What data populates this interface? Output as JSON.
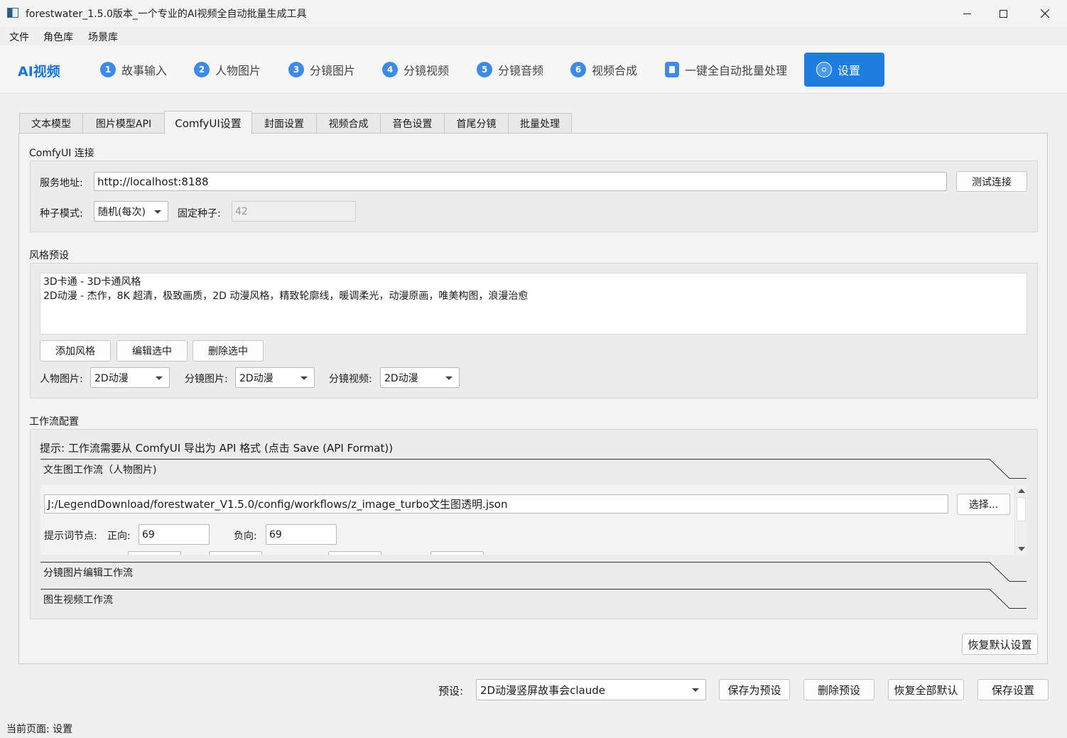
{
  "window": {
    "title": "forestwater_1.5.0版本_一个专业的AI视频全自动批量生成工具"
  },
  "menubar": [
    "文件",
    "角色库",
    "场景库"
  ],
  "brand": "AI视频",
  "nav_steps": [
    {
      "num": "1",
      "label": "故事输入"
    },
    {
      "num": "2",
      "label": "人物图片"
    },
    {
      "num": "3",
      "label": "分镜图片"
    },
    {
      "num": "4",
      "label": "分镜视频"
    },
    {
      "num": "5",
      "label": "分镜音频"
    },
    {
      "num": "6",
      "label": "视频合成"
    }
  ],
  "nav_batch": {
    "label": "一键全自动批量处理"
  },
  "nav_settings": {
    "label": "设置"
  },
  "settings_tabs": [
    "文本模型",
    "图片模型API",
    "ComfyUI设置",
    "封面设置",
    "视频合成",
    "音色设置",
    "首尾分镜",
    "批量处理"
  ],
  "active_tab": "ComfyUI设置",
  "comfy_connection": {
    "title": "ComfyUI 连接",
    "server_label": "服务地址:",
    "server_value": "http://localhost:8188",
    "test_button": "测试连接",
    "seed_mode_label": "种子模式:",
    "seed_mode_value": "随机(每次)",
    "fixed_seed_label": "固定种子:",
    "fixed_seed_value": "42"
  },
  "style_presets": {
    "title": "风格预设",
    "items": [
      "3D卡通 - 3D卡通风格",
      "2D动漫 - 杰作，8K 超清，极致画质，2D 动漫风格，精致轮廓线，暖调柔光，动漫原画，唯美构图，浪漫治愈"
    ],
    "add_button": "添加风格",
    "edit_button": "编辑选中",
    "delete_button": "删除选中",
    "character_label": "人物图片:",
    "character_value": "2D动漫",
    "storyboard_label": "分镜图片:",
    "storyboard_value": "2D动漫",
    "video_label": "分镜视频:",
    "video_value": "2D动漫"
  },
  "workflow_config": {
    "title": "工作流配置",
    "hint": "提示: 工作流需要从 ComfyUI 导出为 API 格式 (点击 Save (API Format))",
    "sections": [
      {
        "title": "文生图工作流（人物图片)"
      },
      {
        "title": "分镜图片编辑工作流"
      },
      {
        "title": "图生视频工作流"
      }
    ],
    "path_value": "J:/LegendDownload/forestwater_V1.5.0/config/workflows/z_image_turbo文生图透明.json",
    "choose_button": "选择...",
    "prompt_node_label": "提示词节点:",
    "positive_label": "正向:",
    "positive_value": "69",
    "negative_label": "负向:",
    "negative_value": "69"
  },
  "restore_defaults_button": "恢复默认设置",
  "bottom_bar": {
    "preset_label": "预设:",
    "preset_value": "2D动漫竖屏故事会claude",
    "save_as_preset": "保存为预设",
    "delete_preset": "删除预设",
    "restore_all": "恢复全部默认",
    "save_settings": "保存设置"
  },
  "status_bar": "当前页面: 设置",
  "colors": {
    "accent": "#1f7de0",
    "brand_text": "#1a73d9",
    "step_badge": "#3d8ae8"
  },
  "icons": [
    "app-icon",
    "minimize-icon",
    "maximize-icon",
    "close-icon",
    "clipboard-icon",
    "gear-icon",
    "dropdown-arrow-icon",
    "scroll-up-icon",
    "scroll-down-icon"
  ]
}
